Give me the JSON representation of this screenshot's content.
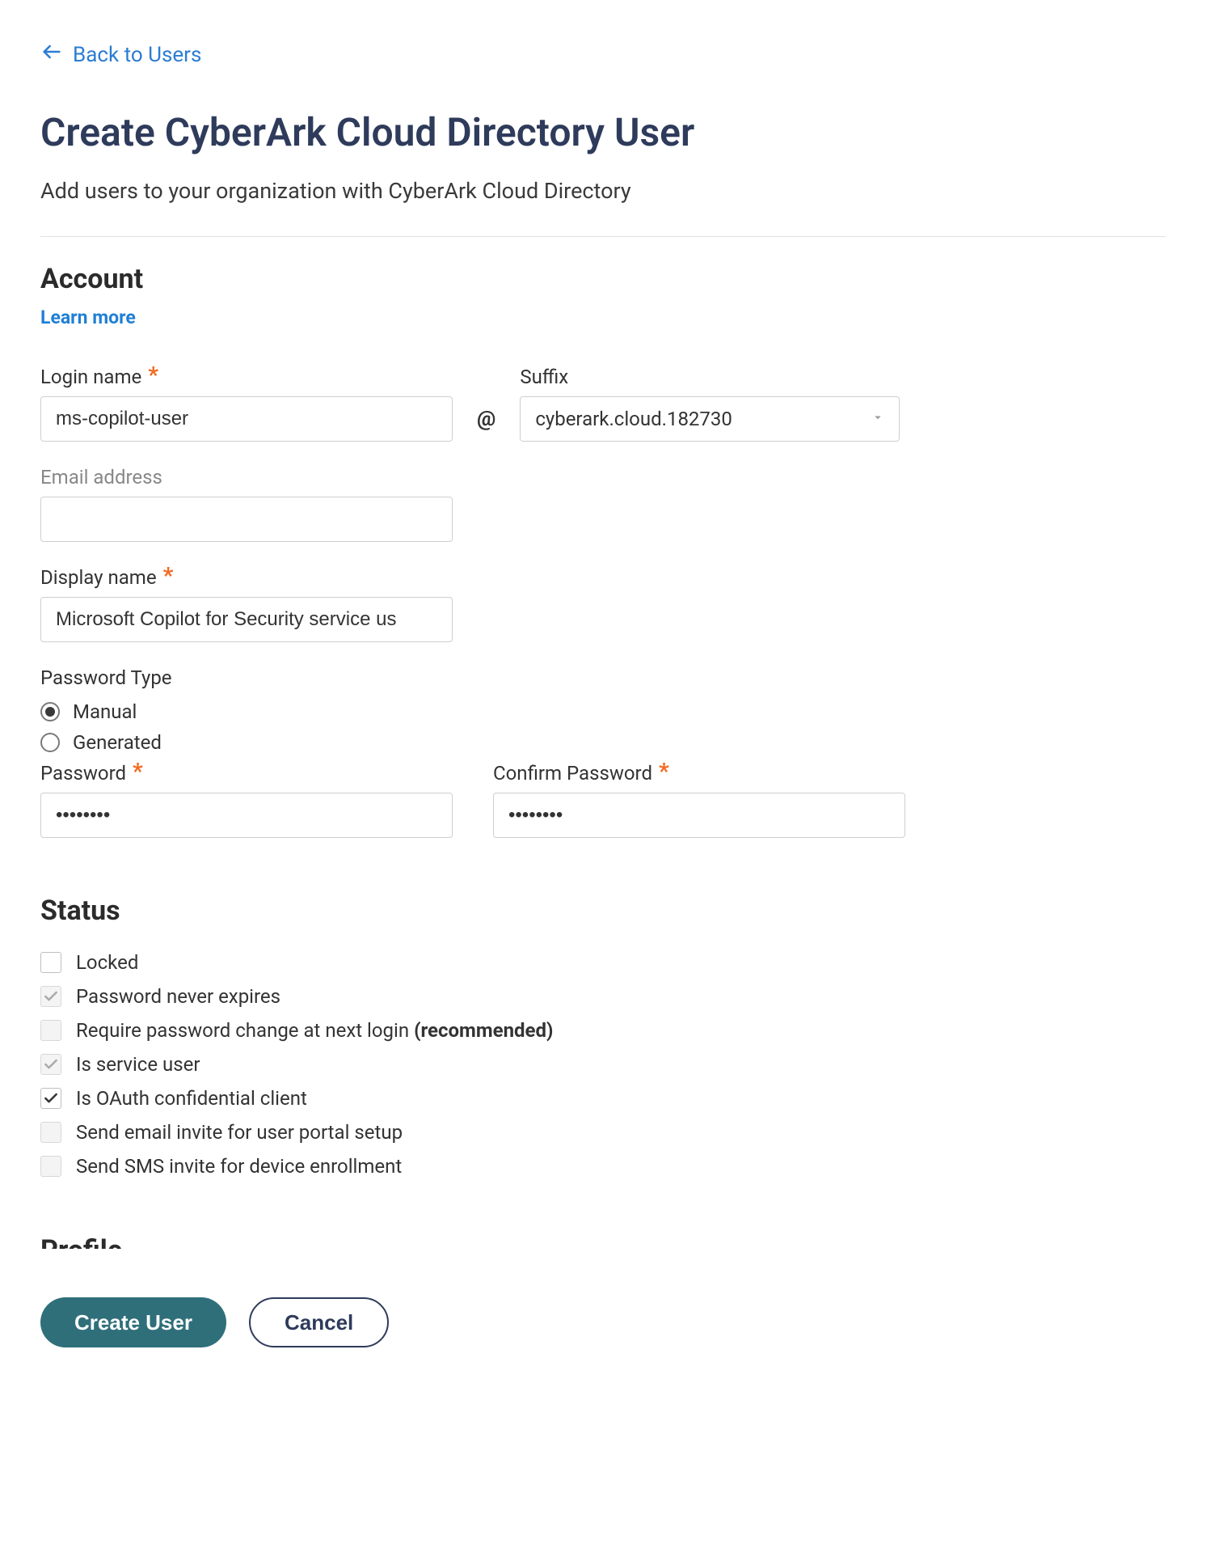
{
  "nav": {
    "back_label": "Back to Users"
  },
  "header": {
    "title": "Create CyberArk Cloud Directory User",
    "subtitle": "Add users to your organization with CyberArk Cloud Directory"
  },
  "account": {
    "heading": "Account",
    "learn_more": "Learn more",
    "login_label": "Login name",
    "login_value": "ms-copilot-user",
    "at": "@",
    "suffix_label": "Suffix",
    "suffix_value": "cyberark.cloud.182730",
    "email_label": "Email address",
    "email_value": "",
    "display_label": "Display name",
    "display_value": "Microsoft Copilot for Security service us",
    "password_type_label": "Password Type",
    "password_type_options": {
      "manual": "Manual",
      "generated": "Generated"
    },
    "password_label": "Password",
    "password_value": "••••••••",
    "confirm_label": "Confirm Password",
    "confirm_value": "••••••••"
  },
  "status": {
    "heading": "Status",
    "items": {
      "locked": "Locked",
      "never_expires": "Password never expires",
      "require_change_prefix": "Require password change at next login ",
      "require_change_rec": "(recommended)",
      "service_user": "Is service user",
      "oauth_client": "Is OAuth confidential client",
      "email_invite": "Send email invite for user portal setup",
      "sms_invite": "Send SMS invite for device enrollment"
    }
  },
  "footer": {
    "create": "Create User",
    "cancel": "Cancel"
  }
}
